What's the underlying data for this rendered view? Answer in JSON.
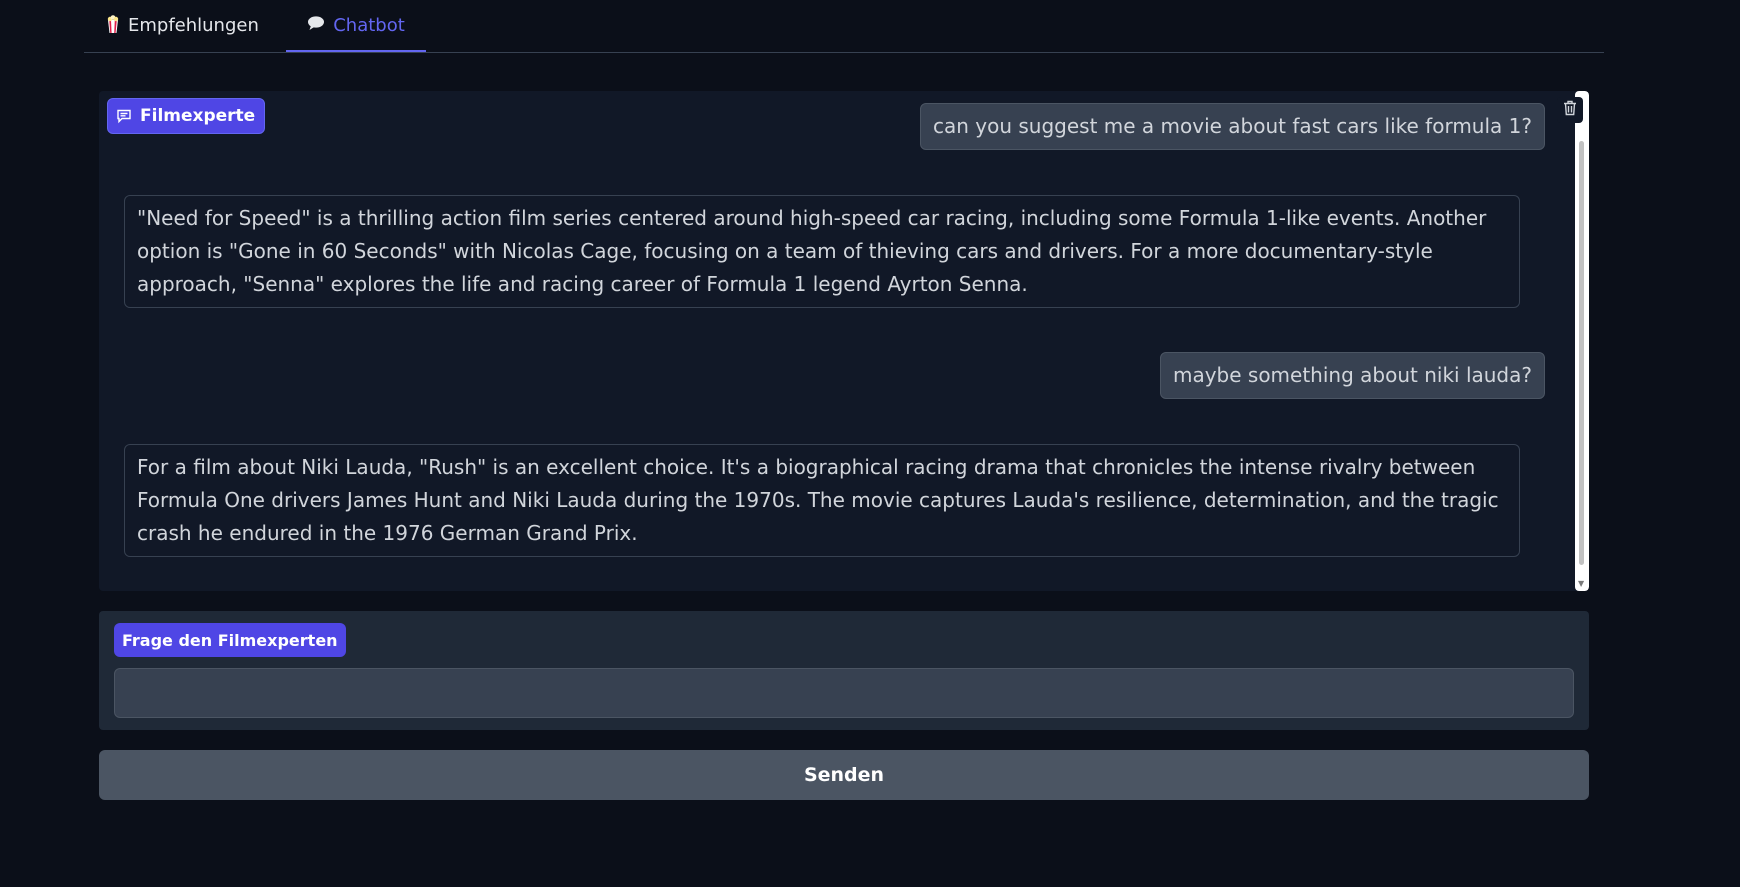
{
  "tabs": [
    {
      "label": "Empfehlungen",
      "icon": "popcorn-icon",
      "active": false
    },
    {
      "label": "Chatbot",
      "icon": "speech-bubble-icon",
      "active": true
    }
  ],
  "chatbot": {
    "label": "Filmexperte",
    "messages": [
      {
        "role": "user",
        "text": "can you suggest me a movie about fast cars like formula 1?"
      },
      {
        "role": "bot",
        "text": "\"Need for Speed\" is a thrilling action film series centered around high-speed car racing, including some Formula 1-like events. Another option is \"Gone in 60 Seconds\" with Nicolas Cage, focusing on a team of thieving cars and drivers. For a more documentary-style approach, \"Senna\" explores the life and racing career of Formula 1 legend Ayrton Senna."
      },
      {
        "role": "user",
        "text": "maybe something about niki lauda?"
      },
      {
        "role": "bot",
        "text": "For a film about Niki Lauda, \"Rush\" is an excellent choice. It's a biographical racing drama that chronicles the intense rivalry between Formula One drivers James Hunt and Niki Lauda during the 1970s. The movie captures Lauda's resilience, determination, and the tragic crash he endured in the 1976 German Grand Prix."
      }
    ]
  },
  "input": {
    "label": "Frage den Filmexperten",
    "value": "",
    "placeholder": ""
  },
  "send_button": {
    "label": "Senden"
  },
  "colors": {
    "background": "#0b0f19",
    "panel": "#111827",
    "accent": "#4f46e5",
    "accent_text": "#6366f1",
    "user_bubble": "#374151",
    "button": "#4b5563"
  }
}
